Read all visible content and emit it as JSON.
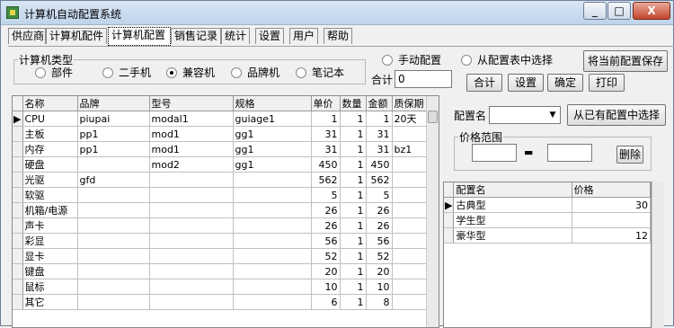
{
  "window": {
    "title": "计算机自动配置系统",
    "min": "_",
    "max": "□",
    "close": "X"
  },
  "menu_tabs": [
    "供应商",
    "计算机配件",
    "计算机配置",
    "销售记录",
    "统计",
    "设置",
    "用户",
    "帮助"
  ],
  "active_tab": "计算机配置",
  "type_group": {
    "legend": "计算机类型",
    "options": [
      {
        "label": "部件",
        "checked": false
      },
      {
        "label": "二手机",
        "checked": false
      },
      {
        "label": "兼容机",
        "checked": true
      },
      {
        "label": "品牌机",
        "checked": false
      },
      {
        "label": "笔记本",
        "checked": false
      }
    ]
  },
  "mode_options": [
    {
      "label": "手动配置",
      "checked": false
    },
    {
      "label": "从配置表中选择",
      "checked": false
    }
  ],
  "save_button": "将当前配置保存",
  "total": {
    "label": "合计",
    "value": "0"
  },
  "action_buttons": [
    "合计",
    "设置",
    "确定",
    "打印"
  ],
  "parts_table": {
    "columns": [
      "名称",
      "品牌",
      "型号",
      "规格",
      "单价",
      "数量",
      "金额",
      "质保期"
    ],
    "rows": [
      [
        "CPU",
        "piupai",
        "modal1",
        "guiage1",
        "1",
        "1",
        "1",
        "20天"
      ],
      [
        "主板",
        "pp1",
        "mod1",
        "gg1",
        "31",
        "1",
        "31",
        ""
      ],
      [
        "内存",
        "pp1",
        "mod1",
        "gg1",
        "31",
        "1",
        "31",
        "bz1"
      ],
      [
        "硬盘",
        "",
        "mod2",
        "gg1",
        "450",
        "1",
        "450",
        ""
      ],
      [
        "光驱",
        "gfd",
        "",
        "",
        "562",
        "1",
        "562",
        ""
      ],
      [
        "软驱",
        "",
        "",
        "",
        "5",
        "1",
        "5",
        ""
      ],
      [
        "机箱/电源",
        "",
        "",
        "",
        "26",
        "1",
        "26",
        ""
      ],
      [
        "声卡",
        "",
        "",
        "",
        "26",
        "1",
        "26",
        ""
      ],
      [
        "彩显",
        "",
        "",
        "",
        "56",
        "1",
        "56",
        ""
      ],
      [
        "显卡",
        "",
        "",
        "",
        "52",
        "1",
        "52",
        ""
      ],
      [
        "键盘",
        "",
        "",
        "",
        "20",
        "1",
        "20",
        ""
      ],
      [
        "鼠标",
        "",
        "",
        "",
        "10",
        "1",
        "10",
        ""
      ],
      [
        "其它",
        "",
        "",
        "",
        "6",
        "1",
        "8",
        ""
      ]
    ]
  },
  "config": {
    "name_label": "配置名",
    "name_value": "",
    "select_button": "从已有配置中选择",
    "price_range_legend": "价格范围",
    "dash": "▬",
    "delete_button": "删除"
  },
  "config_table": {
    "columns": [
      "配置名",
      "价格"
    ],
    "rows": [
      [
        "古典型",
        "30"
      ],
      [
        "学生型",
        ""
      ],
      [
        "豪华型",
        "12"
      ]
    ]
  }
}
